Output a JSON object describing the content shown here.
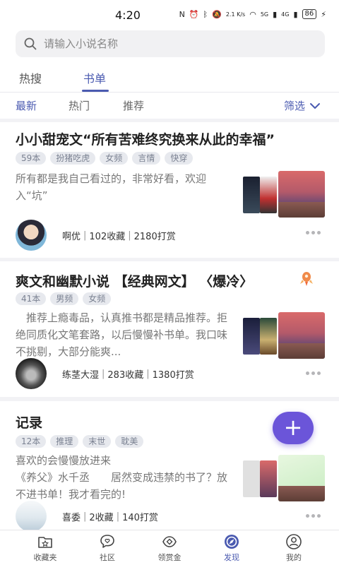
{
  "status": {
    "time": "4:20",
    "net": "2.1 K/s",
    "signal1": "5G",
    "signal2": "4G",
    "battery": "86"
  },
  "search": {
    "placeholder": "请输入小说名称"
  },
  "tabs": [
    {
      "label": "热搜"
    },
    {
      "label": "书单"
    }
  ],
  "subtabs": [
    {
      "label": "最新"
    },
    {
      "label": "热门"
    },
    {
      "label": "推荐"
    }
  ],
  "filter": {
    "label": "筛选"
  },
  "cards": [
    {
      "title": "小小甜宠文“所有苦难终究换来从此的幸福”",
      "tags": [
        "59本",
        "扮猪吃虎",
        "女频",
        "言情",
        "快穿"
      ],
      "desc": "所有都是我自己看过的，非常好看，欢迎入“坑”",
      "author": "啊优",
      "favorites": "102收藏",
      "rewards": "2180打赏"
    },
    {
      "title": "爽文和幽默小说 【经典网文】 〈爆冷〉",
      "tags": [
        "41本",
        "男频",
        "女频"
      ],
      "desc": "　推荐上瘾毒品，认真推书都是精品推荐。拒绝同质化文笔套路，以后慢慢补书单。我口味不挑剔，大部分能爽...",
      "author": "练茎大湿",
      "favorites": "283收藏",
      "rewards": "1380打赏"
    },
    {
      "title": "记录",
      "tags": [
        "12本",
        "推理",
        "末世",
        "耽美"
      ],
      "desc": "喜欢的会慢慢放进来\n《养父》水千丞　　居然变成违禁的书了？放不进书单！我才看完的!",
      "author": "喜委",
      "favorites": "2收藏",
      "rewards": "140打赏"
    }
  ],
  "fab": {
    "label": "+"
  },
  "nav": [
    {
      "label": "收藏夹",
      "icon": "bookmark-folder-icon"
    },
    {
      "label": "社区",
      "icon": "chat-heart-icon"
    },
    {
      "label": "领赏金",
      "icon": "reward-icon"
    },
    {
      "label": "发现",
      "icon": "compass-icon"
    },
    {
      "label": "我的",
      "icon": "profile-icon"
    }
  ],
  "colors": {
    "accent": "#4a5ab0",
    "fab": "#6b55d9"
  }
}
